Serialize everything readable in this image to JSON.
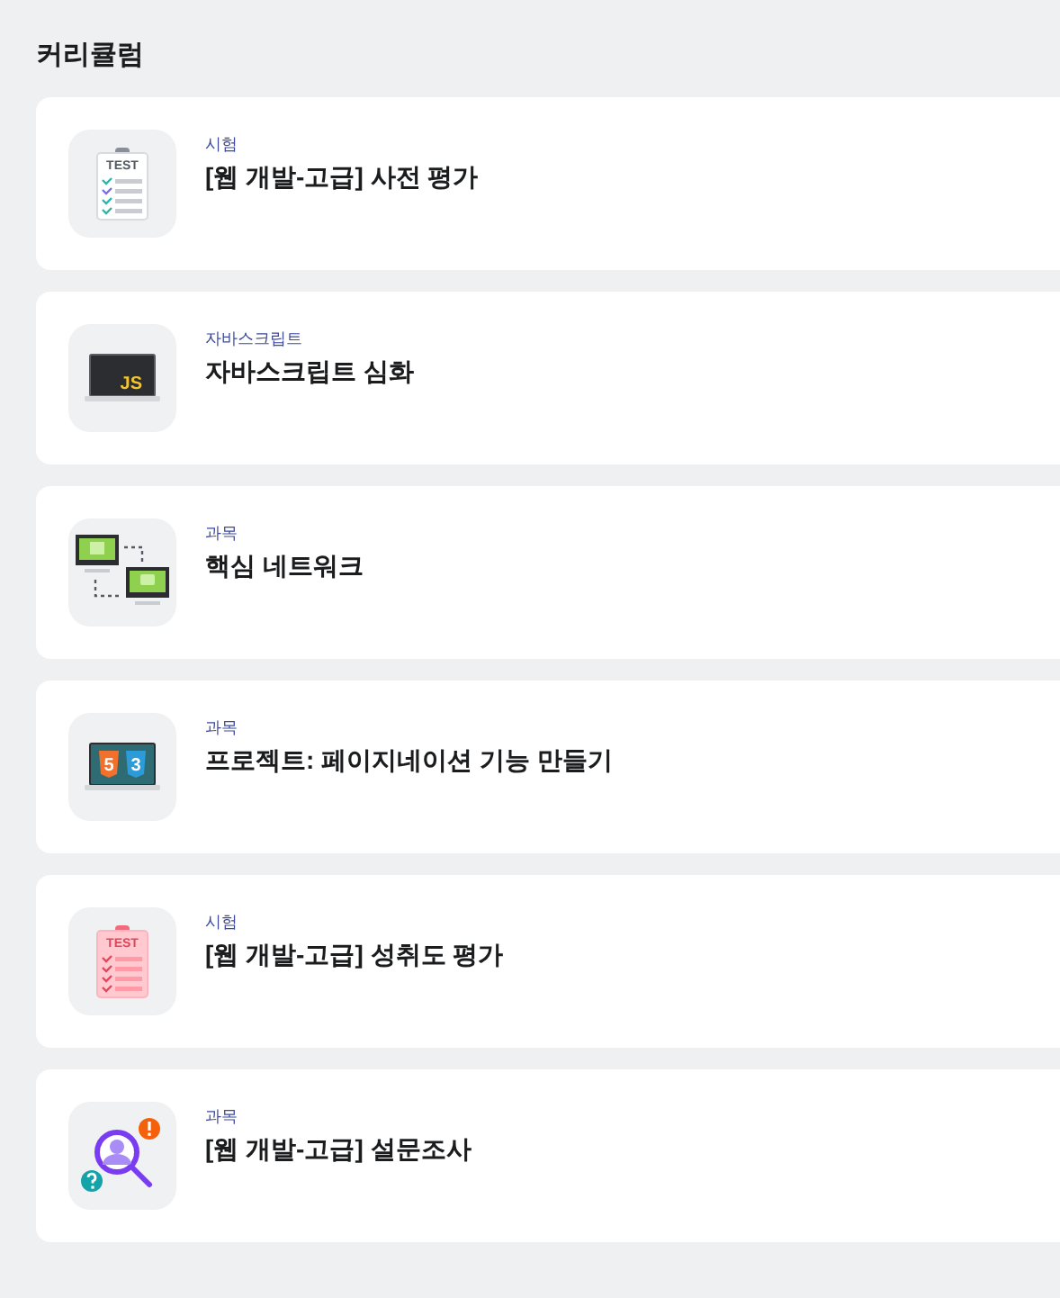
{
  "heading": "커리큘럼",
  "items": [
    {
      "category": "시험",
      "title": "[웹 개발-고급] 사전 평가",
      "icon": {
        "kind": "exam",
        "labels": [
          "TEST"
        ]
      }
    },
    {
      "category": "자바스크립트",
      "title": "자바스크립트 심화",
      "icon": {
        "kind": "js",
        "labels": [
          "JS"
        ]
      }
    },
    {
      "category": "과목",
      "title": "핵심 네트워크",
      "icon": {
        "kind": "network"
      }
    },
    {
      "category": "과목",
      "title": "프로젝트: 페이지네이션 기능 만들기",
      "icon": {
        "kind": "web",
        "labels": [
          "5",
          "3"
        ]
      }
    },
    {
      "category": "시험",
      "title": "[웹 개발-고급] 성취도 평가",
      "icon": {
        "kind": "result",
        "labels": [
          "TEST"
        ]
      }
    },
    {
      "category": "과목",
      "title": "[웹 개발-고급] 설문조사",
      "icon": {
        "kind": "survey"
      }
    }
  ]
}
